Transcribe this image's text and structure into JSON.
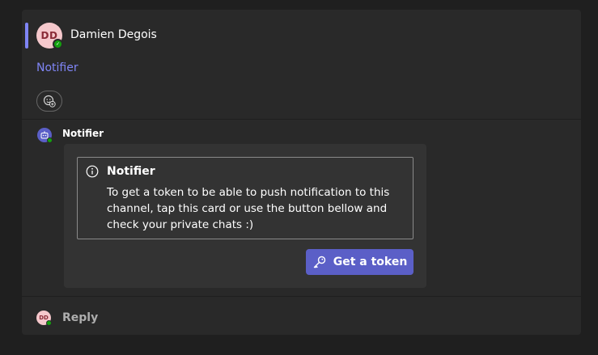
{
  "root_message": {
    "author_initials": "DD",
    "author_name": "Damien Degois",
    "text": "Notifier"
  },
  "bot_reply": {
    "author": "Notifier",
    "card": {
      "title": "Notifier",
      "body": "To get a token to be able to push notification to this channel, tap this card or use the button bellow and check your private chats :)",
      "button_label": "Get a token"
    }
  },
  "reply_bar": {
    "avatar_initials": "DD",
    "label": "Reply"
  },
  "colors": {
    "accent": "#7f85f5",
    "brand": "#5b5fc7",
    "presence": "#13a10e"
  }
}
